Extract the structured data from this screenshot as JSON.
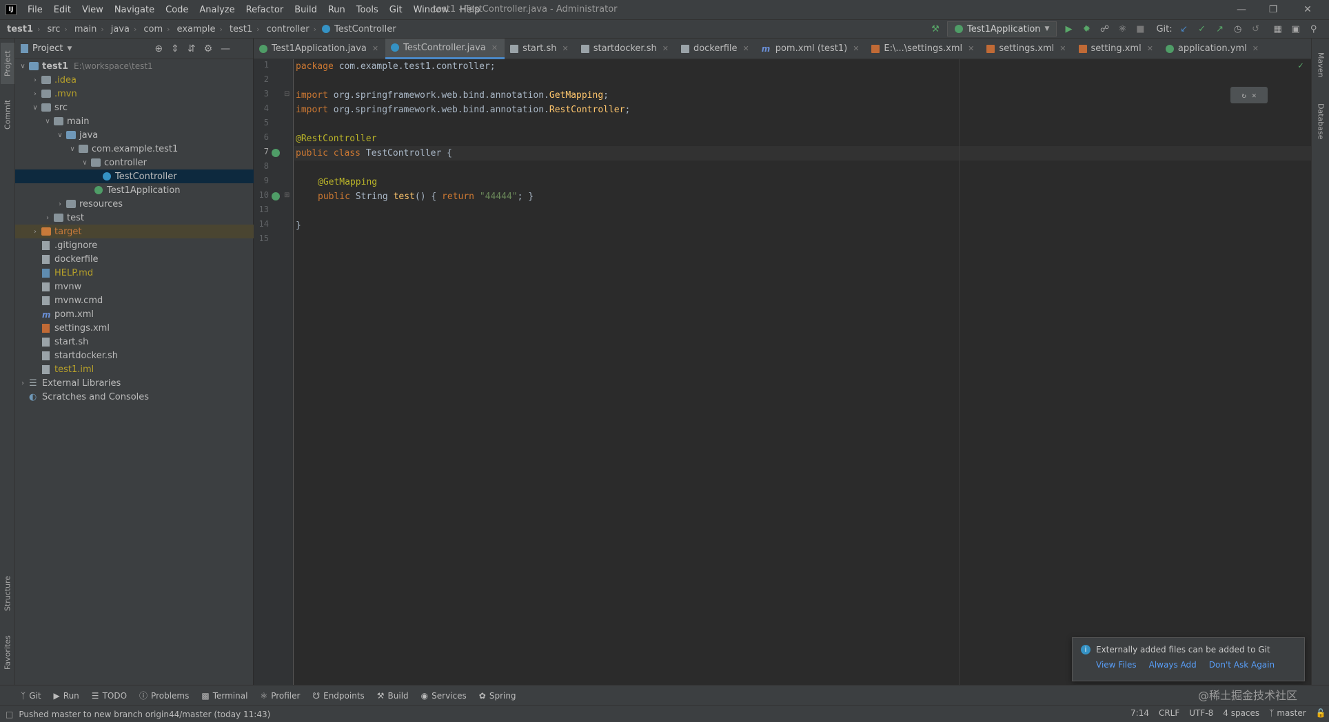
{
  "app": {
    "window_title": "test1 - TestController.java - Administrator",
    "logo": "IJ",
    "menu": [
      "File",
      "Edit",
      "View",
      "Navigate",
      "Code",
      "Analyze",
      "Refactor",
      "Build",
      "Run",
      "Tools",
      "Git",
      "Window",
      "Help"
    ]
  },
  "breadcrumb": [
    "test1",
    "src",
    "main",
    "java",
    "com",
    "example",
    "test1",
    "controller",
    "TestController"
  ],
  "toolbar": {
    "run_config": "Test1Application",
    "git_label": "Git:"
  },
  "side_tabs": {
    "project": "Project",
    "commit": "Commit",
    "structure": "Structure",
    "favorites": "Favorites",
    "maven": "Maven",
    "database": "Database"
  },
  "project_panel": {
    "title": "Project",
    "tree": [
      {
        "label": "test1",
        "extra": "E:\\workspace\\test1"
      },
      {
        "label": ".idea"
      },
      {
        "label": ".mvn"
      },
      {
        "label": "src"
      },
      {
        "label": "main"
      },
      {
        "label": "java"
      },
      {
        "label": "com.example.test1"
      },
      {
        "label": "controller"
      },
      {
        "label": "TestController"
      },
      {
        "label": "Test1Application"
      },
      {
        "label": "resources"
      },
      {
        "label": "test"
      },
      {
        "label": "target"
      },
      {
        "label": ".gitignore"
      },
      {
        "label": "dockerfile"
      },
      {
        "label": "HELP.md"
      },
      {
        "label": "mvnw"
      },
      {
        "label": "mvnw.cmd"
      },
      {
        "label": "pom.xml"
      },
      {
        "label": "settings.xml"
      },
      {
        "label": "start.sh"
      },
      {
        "label": "startdocker.sh"
      },
      {
        "label": "test1.iml"
      },
      {
        "label": "External Libraries"
      },
      {
        "label": "Scratches and Consoles"
      }
    ]
  },
  "tabs": [
    "Test1Application.java",
    "TestController.java",
    "start.sh",
    "startdocker.sh",
    "dockerfile",
    "pom.xml (test1)",
    "E:\\...\\settings.xml",
    "settings.xml",
    "setting.xml",
    "application.yml"
  ],
  "editor": {
    "line_numbers": [
      "1",
      "2",
      "3",
      "4",
      "5",
      "6",
      "7",
      "8",
      "9",
      "10",
      "13",
      "14",
      "15"
    ],
    "code": {
      "l1_kw": "package",
      "l1_rest": " com.example.test1.controller;",
      "l3_kw": "import",
      "l3_a": " org.springframework.web.bind.annotation.",
      "l3_b": "GetMapping",
      "l3_c": ";",
      "l4_kw": "import",
      "l4_a": " org.springframework.web.bind.annotation.",
      "l4_b": "RestController",
      "l4_c": ";",
      "l6_an": "@RestController",
      "l7_kw": "public class",
      "l7_rest": " TestController {",
      "l9_an": "@GetMapping",
      "l10_kw": "public",
      "l10_a": " String ",
      "l10_fn": "test",
      "l10_b": "() { ",
      "l10_kw2": "return",
      "l10_str": " \"44444\"",
      "l10_c": "; }",
      "l14": "}"
    }
  },
  "bottom_tools": [
    "Git",
    "Run",
    "TODO",
    "Problems",
    "Terminal",
    "Profiler",
    "Endpoints",
    "Build",
    "Services",
    "Spring"
  ],
  "status": {
    "message": "Pushed master to new branch origin44/master (today 11:43)",
    "position": "7:14",
    "line_sep": "CRLF",
    "encoding": "UTF-8",
    "indent": "4 spaces",
    "branch": "master"
  },
  "notification": {
    "text": "Externally added files can be added to Git",
    "link1": "View Files",
    "link2": "Always Add",
    "link3": "Don't Ask Again"
  },
  "watermark": "@稀土掘金技术社区"
}
